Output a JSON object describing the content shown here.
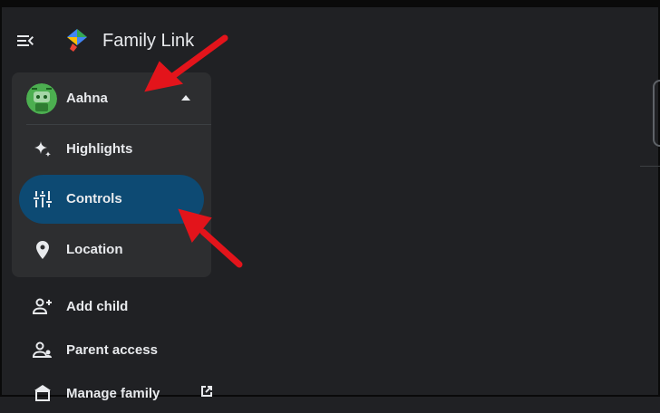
{
  "app": {
    "title": "Family Link"
  },
  "child": {
    "name": "Aahna"
  },
  "child_nav": [
    {
      "label": "Highlights",
      "icon": "sparkle-icon",
      "active": false
    },
    {
      "label": "Controls",
      "icon": "tune-sliders-icon",
      "active": true
    },
    {
      "label": "Location",
      "icon": "location-pin-icon",
      "active": false
    }
  ],
  "side_nav": [
    {
      "label": "Add child",
      "icon": "add-person-icon"
    },
    {
      "label": "Parent access",
      "icon": "parent-access-icon"
    },
    {
      "label": "Manage family",
      "icon": "family-icon",
      "external": true
    }
  ],
  "colors": {
    "background": "#202124",
    "card": "#2d2e30",
    "active_item": "#0d4a73",
    "annotation_arrow": "#e3141b",
    "avatar_green": "#4caf50"
  }
}
